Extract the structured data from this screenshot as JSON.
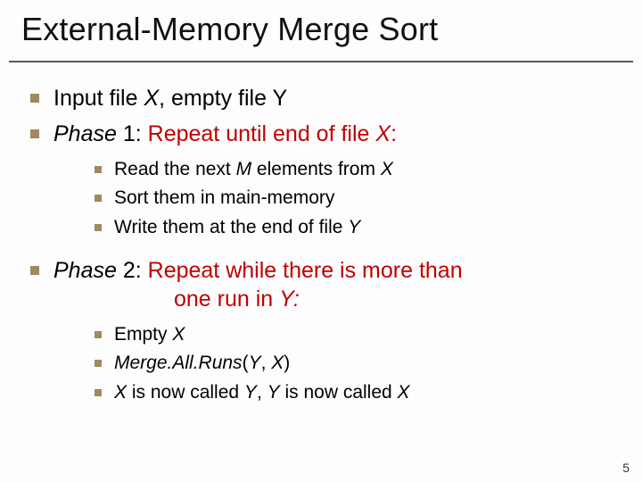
{
  "title": "External-Memory Merge Sort",
  "l1": {
    "item1": {
      "pre": "Input file ",
      "xi": "X",
      "post": ", empty file Y"
    },
    "item2": {
      "phase": "Phase",
      "rest_a": " 1: ",
      "red": "Repeat until end of file ",
      "red_xi": "X",
      "red_colon": ":"
    },
    "item3": {
      "phase": "Phase",
      "rest_a": " 2: ",
      "red1_a": "Repeat while there is more than",
      "red2_a": "one run in ",
      "red2_yi": "Y",
      "red2_colon": ":"
    }
  },
  "l2a": {
    "i1": {
      "a": "Read the next ",
      "mi": "M",
      "b": " elements from ",
      "xi": "X"
    },
    "i2": "Sort them in main-memory",
    "i3": {
      "a": "Write them at the end of file ",
      "yi": "Y"
    }
  },
  "l2b": {
    "i1": {
      "a": "Empty ",
      "xi": "X"
    },
    "i2": {
      "a": "Merge.All.Runs",
      "b": "(",
      "yi": "Y",
      "c": ", ",
      "xi": "X",
      "d": ")"
    },
    "i3": {
      "xi1": "X",
      "a": " is now called ",
      "yi": "Y",
      "b": ", ",
      "yi2": "Y",
      "c": " is now called ",
      "xi2": "X"
    }
  },
  "pagenum": "5"
}
